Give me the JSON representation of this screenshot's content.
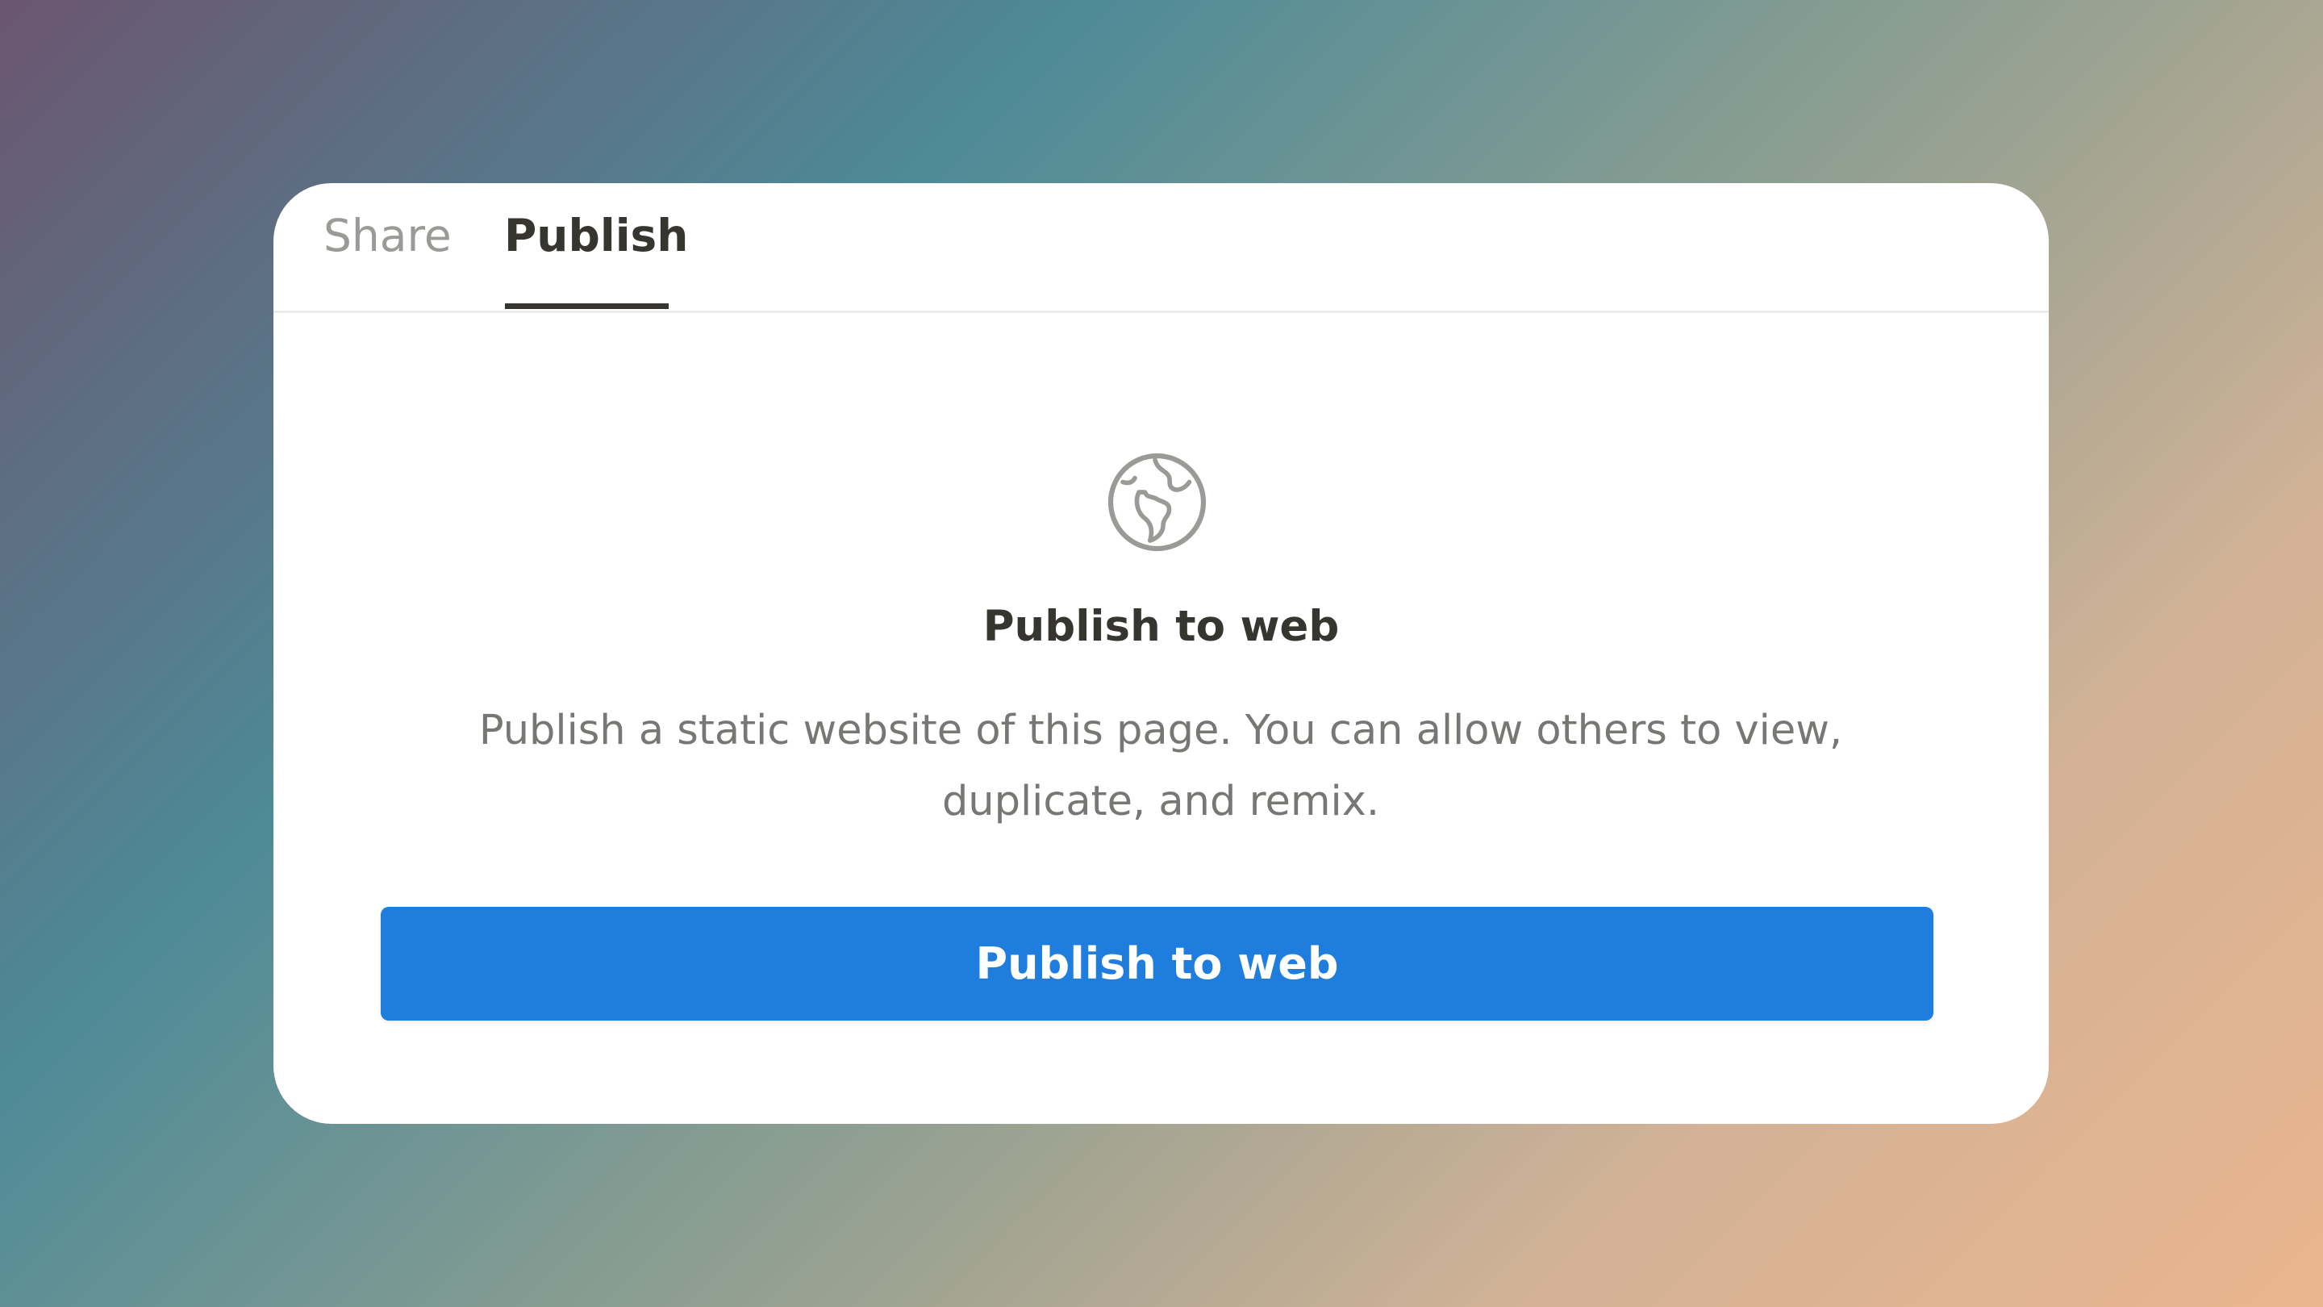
{
  "tabs": [
    {
      "label": "Share",
      "active": false
    },
    {
      "label": "Publish",
      "active": true
    }
  ],
  "publish_panel": {
    "icon": "globe-icon",
    "title": "Publish to web",
    "description": "Publish a static website of this page. You can allow others to view, duplicate, and remix.",
    "button_label": "Publish to web"
  },
  "colors": {
    "accent": "#1e7ddd",
    "text_primary": "#37352f",
    "text_secondary": "#787774",
    "tab_inactive": "#9b9a97"
  }
}
